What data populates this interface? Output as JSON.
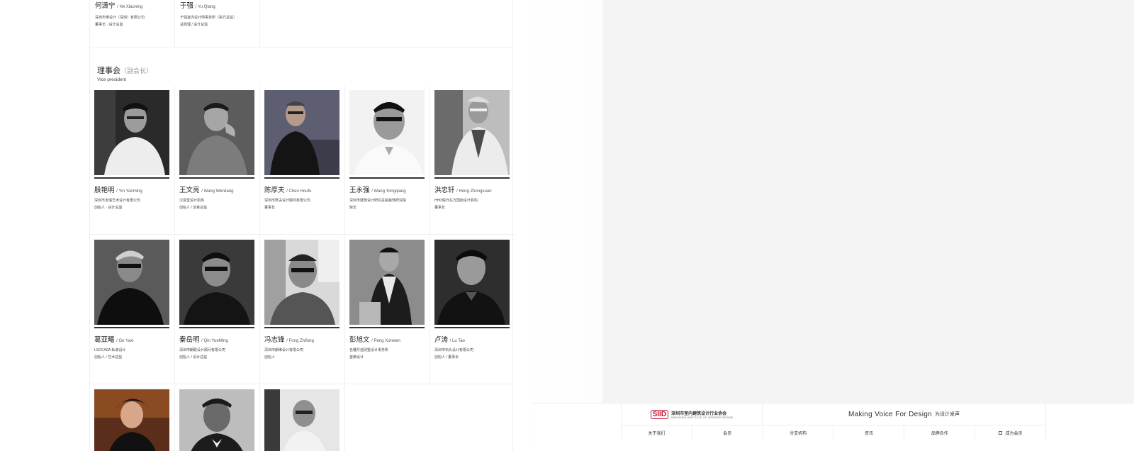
{
  "top_members": [
    {
      "name": "何潇宁",
      "en": "/ He Xiaoning",
      "line1": "深圳市维设计（深圳）有限公司",
      "line2": "董事长 · 设计总监"
    },
    {
      "name": "于强",
      "en": "/ Yu Qiang",
      "line1": "于强室内设计师事务所（执行总监）",
      "line2": "总经理 / 设计总监"
    }
  ],
  "section": {
    "title": "理事会",
    "title_note": "（副会长）",
    "subtitle": "Vice president"
  },
  "members": [
    {
      "name": "殷艳明",
      "en": "/ Yin Yanming",
      "line1": "深圳市吉瑞艺术设计有限公司",
      "line2": "创始人 · 设计总监"
    },
    {
      "name": "王文亮",
      "en": "/ Wang Wenliang",
      "line1": "汉意堂设计机构",
      "line2": "创始人 / 创意总监"
    },
    {
      "name": "陈厚夫",
      "en": "/ Chen Houfu",
      "line1": "深圳市厚夫设计顾问有限公司",
      "line2": "董事长"
    },
    {
      "name": "王永强",
      "en": "/ Wang Yongqiang",
      "line1": "深圳市建筑设计研究总院装饰研究院",
      "line2": "院长"
    },
    {
      "name": "洪忠轩",
      "en": "/ Hong Zhongxuan",
      "line1": "HHD假日东方国际设计机构",
      "line2": "董事长"
    },
    {
      "name": "葛亚曦",
      "en": "/ Ge Yaxi",
      "line1": "LSDCASA 私家设计",
      "line2": "创始人 / 艺术总监"
    },
    {
      "name": "秦岳明",
      "en": "/ Qin YueMing",
      "line1": "深圳市朗联设计顾问有限公司",
      "line2": "创始人 / 设计总监"
    },
    {
      "name": "冯志锋",
      "en": "/ Fong Zhifong",
      "line1": "深圳市朗维设计有限公司",
      "line2": "创始人"
    },
    {
      "name": "彭旭文",
      "en": "/ Peng Xunwen",
      "line1": "名雕丹迪别墅设计事务所",
      "line2": "首席设计"
    },
    {
      "name": "卢涛",
      "en": "/ Lu Tao",
      "line1": "深圳市石头设计有限公司",
      "line2": "创始人 / 董事长"
    }
  ],
  "footer": {
    "logo_mark": "SIID",
    "org_name_cn": "深圳市室内建筑设计行业协会",
    "org_name_en": "SHENZHEN INSTITUTE OF INTERIOR DESIGN",
    "slogan_en": "Making Voice For Design",
    "slogan_cn": "为设计发声",
    "nav": [
      "关于我们",
      "会员",
      "分支机构",
      "资讯",
      "品牌合作",
      "成为会员"
    ]
  }
}
